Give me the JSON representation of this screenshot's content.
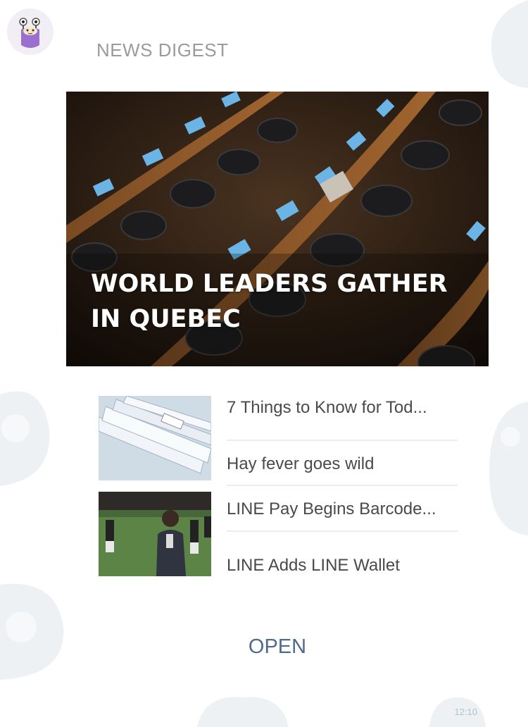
{
  "chat": {
    "avatar_icon": "monster-mascot-icon",
    "timestamp": "12:10"
  },
  "card": {
    "title": "NEWS DIGEST",
    "hero": {
      "headline": "WORLD LEADERS GATHER IN QUEBEC",
      "image": "assembly-hall-photo"
    },
    "thumbnails": [
      {
        "image": "documents-files-photo"
      },
      {
        "image": "soccer-field-photo"
      }
    ],
    "items": [
      {
        "label": "7 Things to Know for Tod..."
      },
      {
        "label": "Hay fever goes wild"
      },
      {
        "label": "LINE Pay Begins Barcode..."
      },
      {
        "label": "LINE Adds LINE Wallet"
      }
    ],
    "open_label": "OPEN"
  },
  "colors": {
    "title": "#9b9b9b",
    "open_button": "#4d6b8c",
    "item_text": "#4a4a4a",
    "timestamp": "#b0c4d4",
    "background": "#ffffff"
  }
}
